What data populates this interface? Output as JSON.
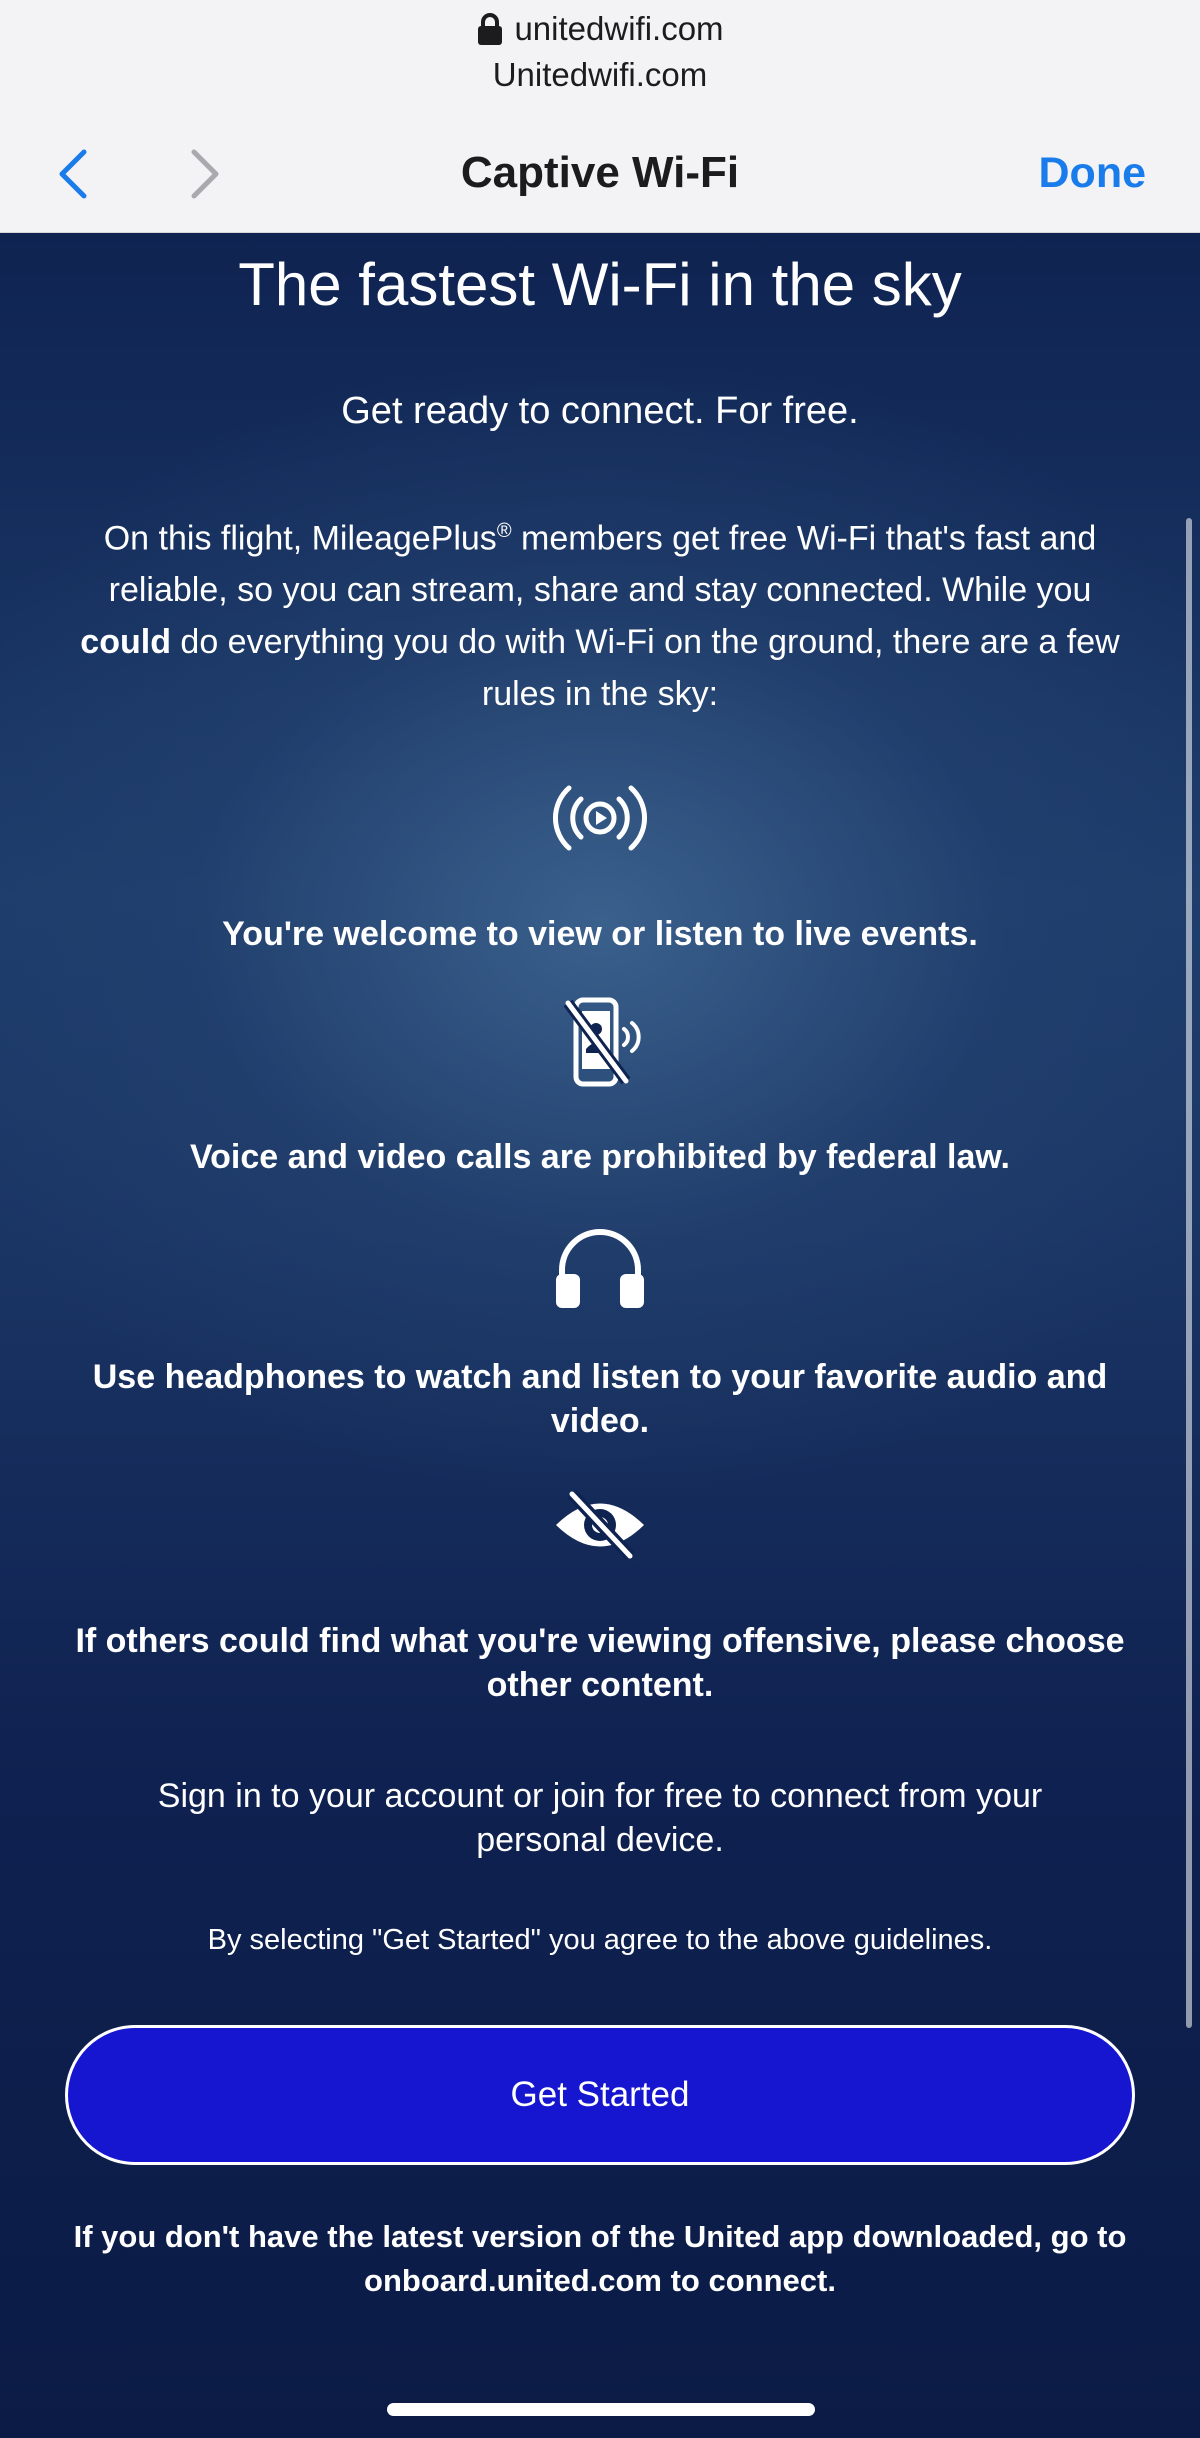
{
  "browser": {
    "url": "unitedwifi.com",
    "site_title": "Unitedwifi.com",
    "page_title": "Captive Wi-Fi",
    "done_label": "Done",
    "accent_color": "#1a7bea"
  },
  "portal": {
    "headline": "The fastest Wi-Fi in the sky",
    "subhead": "Get ready to connect. For free.",
    "intro": {
      "part1": "On this flight, MileagePlus",
      "registered": "®",
      "part2": " members get free Wi-Fi that's fast and reliable, so you can stream, share and stay connected. While you ",
      "bold": "could",
      "part3": " do everything you do with Wi-Fi on the ground, there are a few rules in the sky:"
    },
    "rules": [
      {
        "icon": "live-stream-icon",
        "text": "You're welcome to view or listen to live events."
      },
      {
        "icon": "no-calls-icon",
        "text": "Voice and video calls are prohibited by federal law."
      },
      {
        "icon": "headphones-icon",
        "text": "Use headphones to watch and listen to your favorite audio and video."
      },
      {
        "icon": "eye-slash-icon",
        "text": "If others could find what you're viewing offensive, please choose other content."
      }
    ],
    "signin_text": "Sign in to your account or join for free to connect from your personal device.",
    "agree_text": "By selecting \"Get Started\" you agree to the above guidelines.",
    "cta_label": "Get Started",
    "app_note": "If you don't have the latest version of the United app downloaded, go to onboard.united.com to connect.",
    "background_color": "#0d1f45",
    "cta_color": "#1615d0"
  }
}
